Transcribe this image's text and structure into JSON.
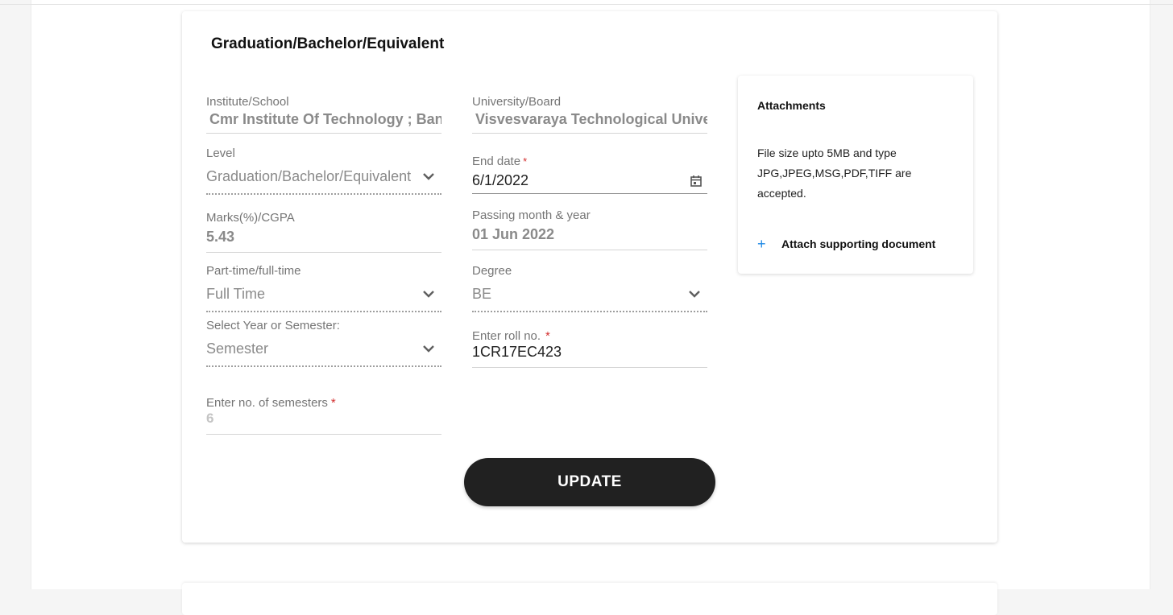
{
  "card": {
    "title": "Graduation/Bachelor/Equivalent"
  },
  "fields": {
    "institute": {
      "label": "Institute/School",
      "value": "Cmr Institute Of Technology ; Bangalore"
    },
    "university": {
      "label": "University/Board",
      "value": "Visvesvaraya Technological University"
    },
    "level": {
      "label": "Level",
      "value": "Graduation/Bachelor/Equivalent",
      "icon": "chevron-down-icon"
    },
    "end_date": {
      "label": "End date",
      "required": "*",
      "value": "6/1/2022",
      "icon": "calendar-icon"
    },
    "marks": {
      "label": "Marks(%)/CGPA",
      "value": "5.43"
    },
    "passing": {
      "label": "Passing month & year",
      "value": "01 Jun 2022"
    },
    "part_time": {
      "label": "Part-time/full-time",
      "value": "Full Time",
      "icon": "chevron-down-icon"
    },
    "degree": {
      "label": "Degree",
      "value": "BE",
      "icon": "chevron-down-icon"
    },
    "year_or_semester": {
      "label": "Select Year or Semester:",
      "value": "Semester",
      "icon": "chevron-down-icon"
    },
    "roll_no": {
      "label": "Enter roll no.",
      "required": "*",
      "value": "1CR17EC423"
    },
    "semesters": {
      "label": "Enter no. of semesters",
      "required": "*",
      "placeholder": "6"
    }
  },
  "attachments": {
    "title": "Attachments",
    "description": "File size upto 5MB and type JPG,JPEG,MSG,PDF,TIFF are accepted.",
    "button_icon": "+",
    "button_label": "Attach supporting document"
  },
  "update_button": {
    "label": "UPDATE"
  },
  "colors": {
    "button_bg": "#212121",
    "required_asterisk": "#d32f2f",
    "plus_icon": "#1e88e5"
  }
}
